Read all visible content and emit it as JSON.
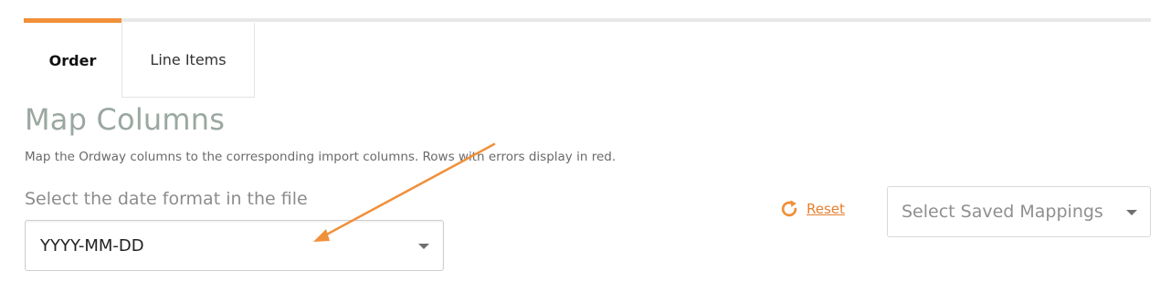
{
  "tabs": [
    {
      "label": "Order"
    },
    {
      "label": "Line Items"
    }
  ],
  "page": {
    "title": "Map Columns",
    "description": "Map the Ordway columns to the corresponding import columns. Rows with errors display in red."
  },
  "date_format": {
    "label": "Select the date format in the file",
    "selected": "YYYY-MM-DD"
  },
  "reset": {
    "label": "Reset",
    "icon": "reset-icon"
  },
  "saved_mappings": {
    "placeholder": "Select Saved Mappings"
  },
  "colors": {
    "accent": "#f0903a",
    "title": "#9aa8a0",
    "reset_text": "#e57f2e"
  }
}
